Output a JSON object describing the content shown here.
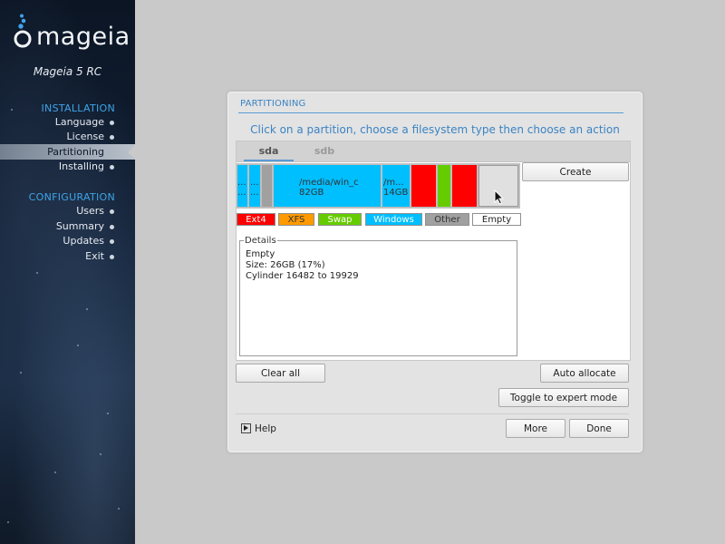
{
  "sidebar": {
    "logo_text": "mageia",
    "product": "Mageia 5 RC",
    "installation_title": "INSTALLATION",
    "installation_items": [
      {
        "label": "Language"
      },
      {
        "label": "License"
      },
      {
        "label": "Partitioning"
      },
      {
        "label": "Installing"
      }
    ],
    "configuration_title": "CONFIGURATION",
    "configuration_items": [
      {
        "label": "Users"
      },
      {
        "label": "Summary"
      },
      {
        "label": "Updates"
      },
      {
        "label": "Exit"
      }
    ],
    "active_item": "Partitioning"
  },
  "dialog": {
    "title": "PARTITIONING",
    "instruction": "Click on a partition, choose a filesystem type then choose an action",
    "tabs": [
      {
        "label": "sda",
        "selected": true
      },
      {
        "label": "sdb",
        "selected": false
      }
    ],
    "partitions": [
      {
        "type": "Windows",
        "line1": "...",
        "line2": "...",
        "color": "#00bfff"
      },
      {
        "type": "Windows",
        "line1": "...",
        "line2": "...",
        "color": "#00bfff"
      },
      {
        "type": "Other",
        "line1": "",
        "line2": "",
        "color": "#a0a0a0"
      },
      {
        "type": "Windows",
        "line1": "/media/win_c",
        "line2": "82GB",
        "color": "#00bfff"
      },
      {
        "type": "Windows",
        "line1": "/m...",
        "line2": "14GB",
        "color": "#00bfff"
      },
      {
        "type": "Ext4",
        "line1": "",
        "line2": "",
        "color": "#ff0000"
      },
      {
        "type": "Swap",
        "line1": "",
        "line2": "",
        "color": "#66cc00"
      },
      {
        "type": "Ext4",
        "line1": "",
        "line2": "",
        "color": "#ff0000"
      },
      {
        "type": "Empty",
        "line1": "",
        "line2": "",
        "color": "#e0e0e0",
        "selected": true
      }
    ],
    "legend": [
      {
        "label": "Ext4",
        "color": "#ff0000"
      },
      {
        "label": "XFS",
        "color": "#ff9900"
      },
      {
        "label": "Swap",
        "color": "#66cc00"
      },
      {
        "label": "Windows",
        "color": "#00bfff"
      },
      {
        "label": "Other",
        "color": "#a0a0a0"
      },
      {
        "label": "Empty",
        "color": "#ffffff"
      }
    ],
    "details": {
      "legend": "Details",
      "line1": "Empty",
      "line2": "Size: 26GB (17%)",
      "line3": "Cylinder 16482 to 19929"
    },
    "buttons": {
      "create": "Create",
      "clear_all": "Clear all",
      "auto_allocate": "Auto allocate",
      "toggle_expert": "Toggle to expert mode",
      "help": "Help",
      "more": "More",
      "done": "Done"
    }
  }
}
